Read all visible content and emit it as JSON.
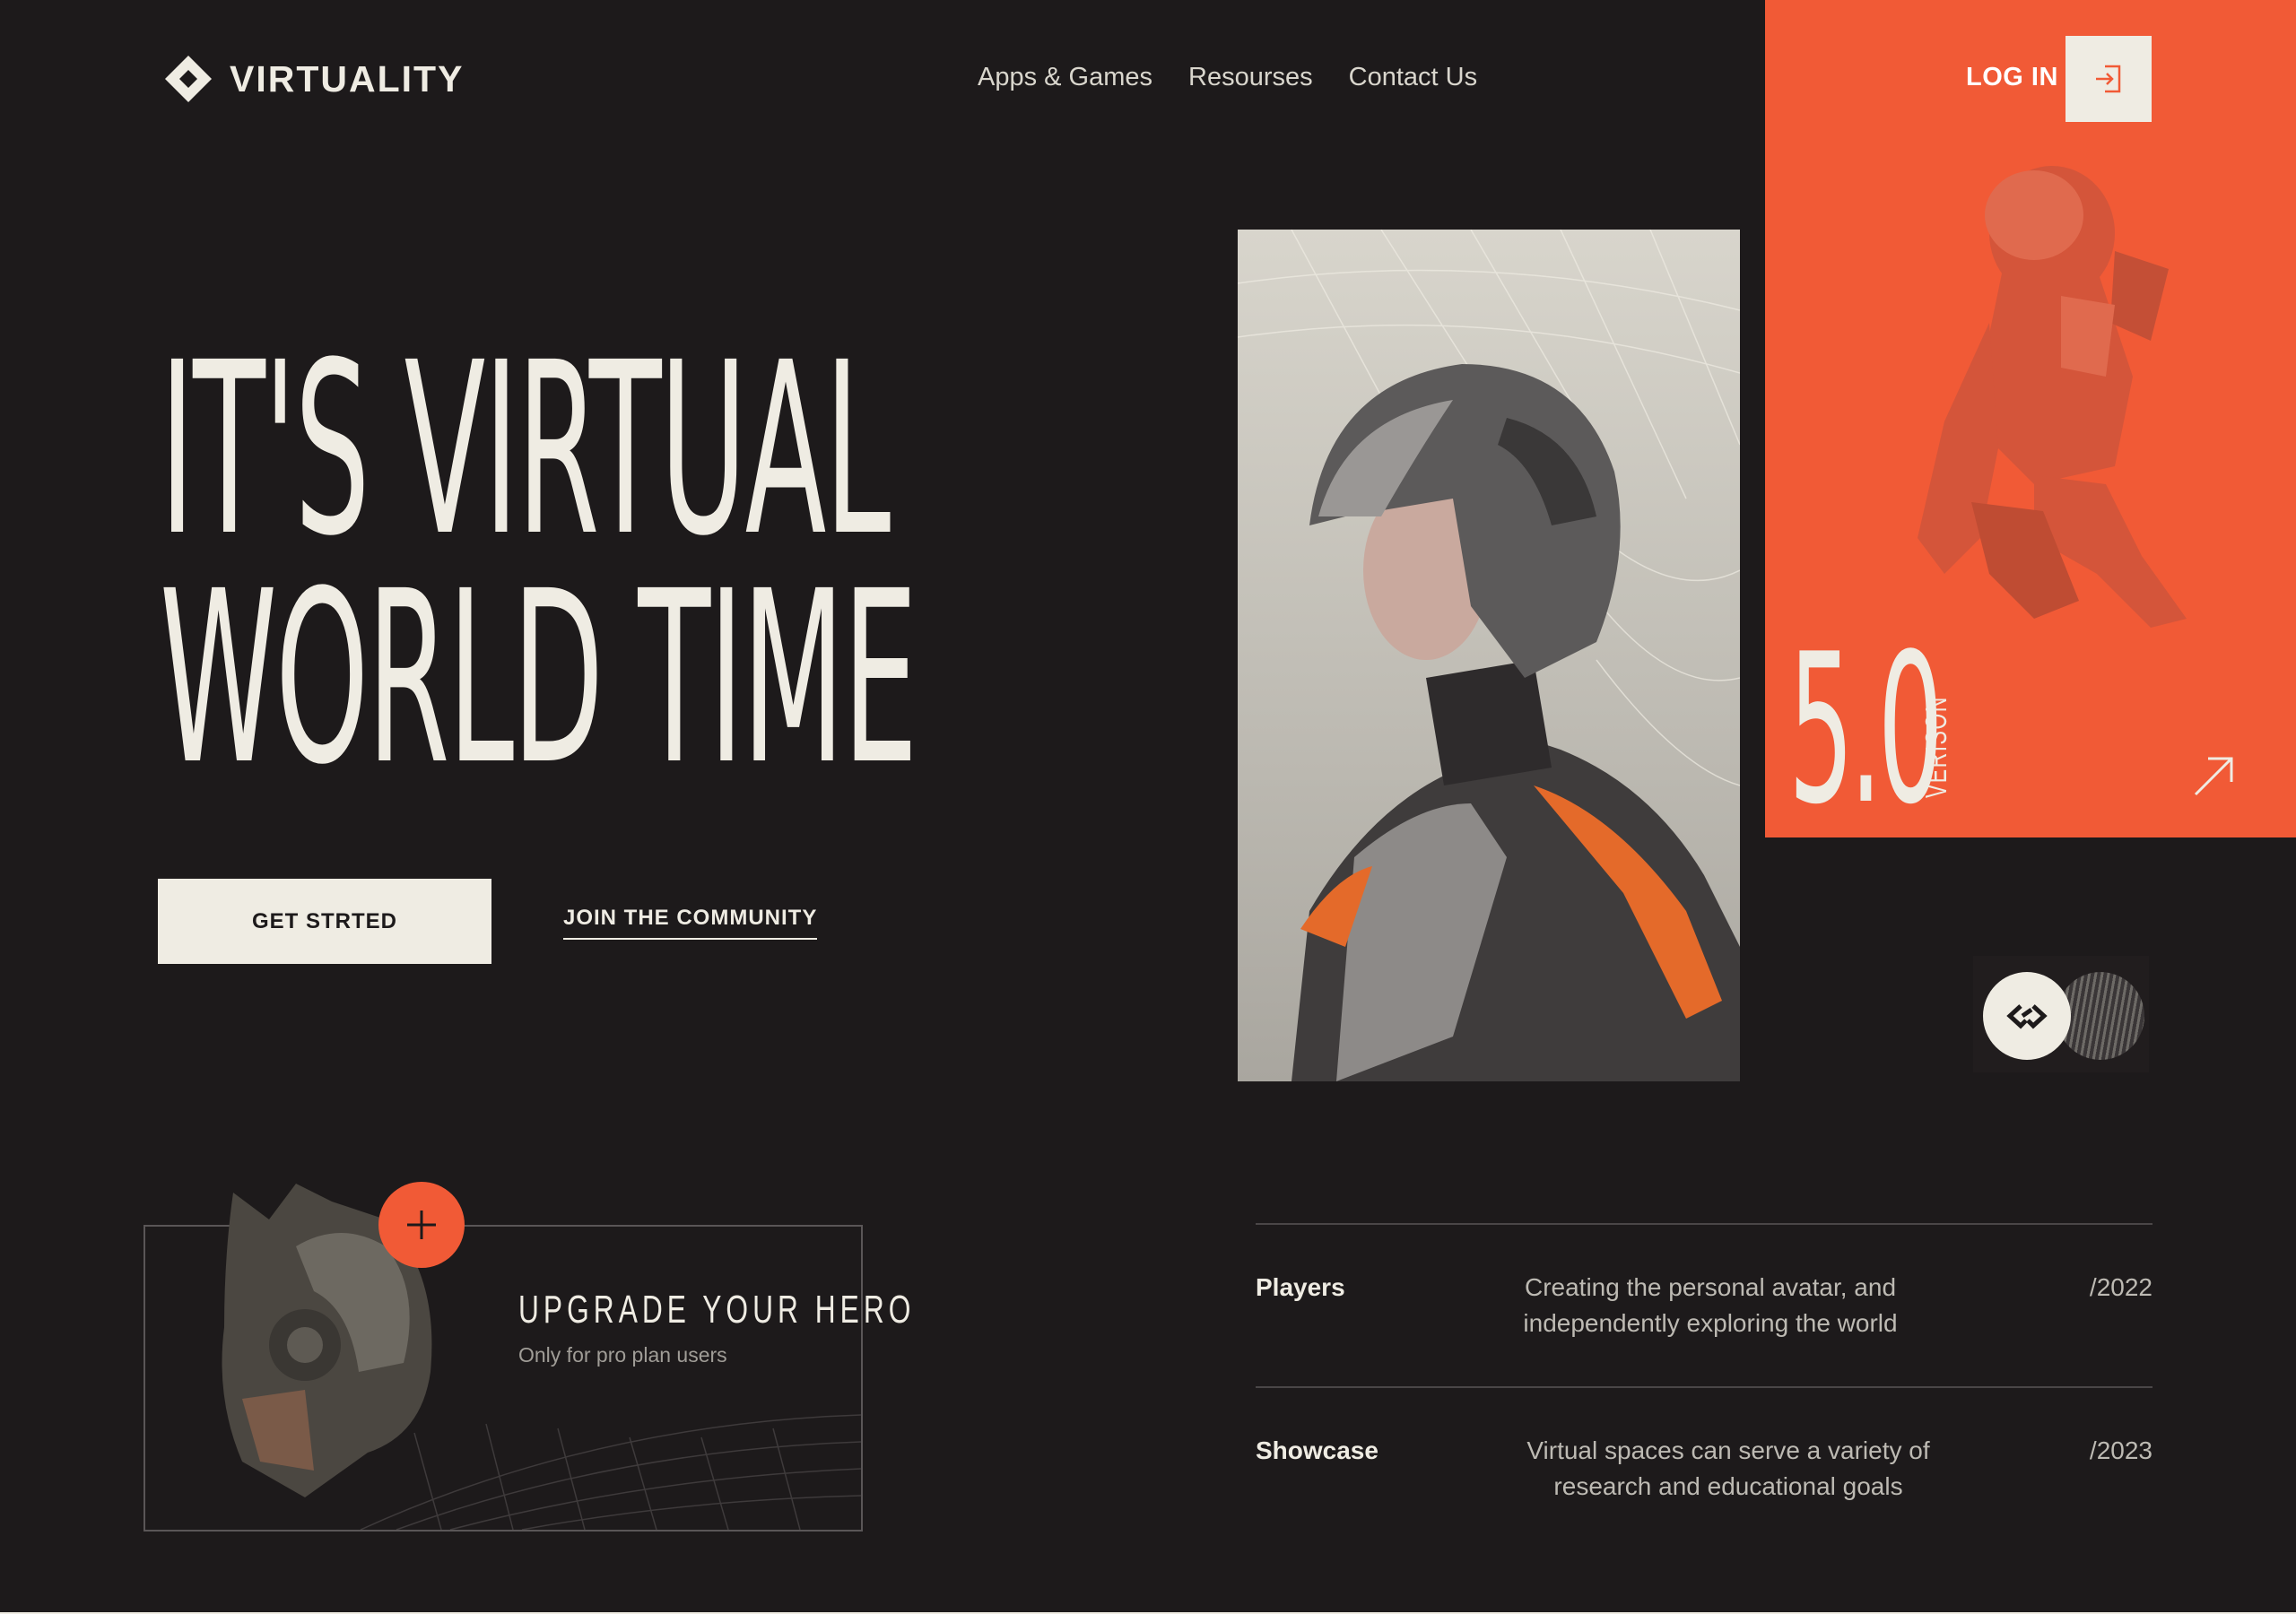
{
  "brand": {
    "name": "VIRTUALITY"
  },
  "nav": {
    "items": [
      "Apps & Games",
      "Resourses",
      "Contact Us"
    ]
  },
  "header": {
    "login_label": "LOG IN"
  },
  "hero": {
    "line1": "IT'S VIRTUAL",
    "line2": "WORLD TIME",
    "cta_primary": "GET STRTED",
    "cta_secondary": "JOIN THE COMMUNITY"
  },
  "version": {
    "number": "5.0",
    "label": "VERISON"
  },
  "upgrade_card": {
    "title": "UPGRADE YOUR HERO",
    "subtitle": "Only for pro plan users"
  },
  "info_rows": [
    {
      "title": "Players",
      "description": "Creating the personal avatar, and independently exploring the world",
      "year": "/2022"
    },
    {
      "title": "Showcase",
      "description": "Virtual spaces can serve a variety of research and educational goals",
      "year": "/2023"
    }
  ],
  "colors": {
    "background": "#1d1a1b",
    "accent": "#f15a36",
    "cream": "#efece3"
  },
  "icons": [
    "diamond-logo-icon",
    "login-icon",
    "arrow-up-right-icon",
    "link-icon",
    "plus-icon"
  ]
}
